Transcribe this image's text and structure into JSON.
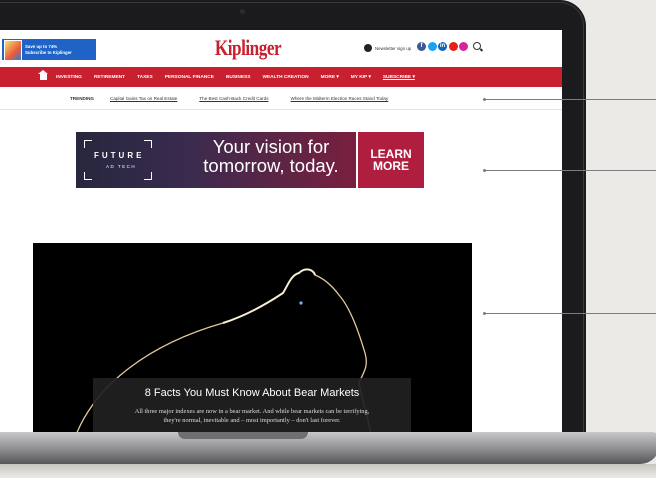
{
  "header": {
    "promo": {
      "line1": "Save up to 74%",
      "line2": "Subscribe to Kiplinger"
    },
    "logo": "Kiplinger",
    "newsletter_label": "Newsletter sign up",
    "social_icons": [
      "facebook-icon",
      "twitter-icon",
      "linkedin-icon",
      "youtube-icon",
      "instagram-icon"
    ]
  },
  "nav": {
    "items": [
      "INVESTING",
      "RETIREMENT",
      "TAXES",
      "PERSONAL FINANCE",
      "BUSINESS",
      "WEALTH CREATION",
      "MORE ▾",
      "MY KIP ▾"
    ],
    "subscribe": "SUBSCRIBE ▾"
  },
  "trending": {
    "label": "TRENDING",
    "links": [
      "Capital Gains Tax on Real Estate",
      "The Best Cash-Back Credit Cards",
      "Where the Midterm Election Races Stand Today"
    ]
  },
  "ad": {
    "brand": "FUTURE",
    "brand_sub": "AD TECH",
    "headline_line1": "Your vision for",
    "headline_line2": "tomorrow, today.",
    "cta_line1": "LEARN",
    "cta_line2": "MORE"
  },
  "hero": {
    "title": "8 Facts You Must Know About Bear Markets",
    "body_line1": "All three major indexes are now in a bear market. And while bear markets can be terrifying,",
    "body_line2": "they're normal, inevitable and – most importantly – don't last forever."
  },
  "colors": {
    "brand_red": "#c8202f",
    "promo_blue": "#1f63c7",
    "ad_cta": "#b01e3f"
  }
}
